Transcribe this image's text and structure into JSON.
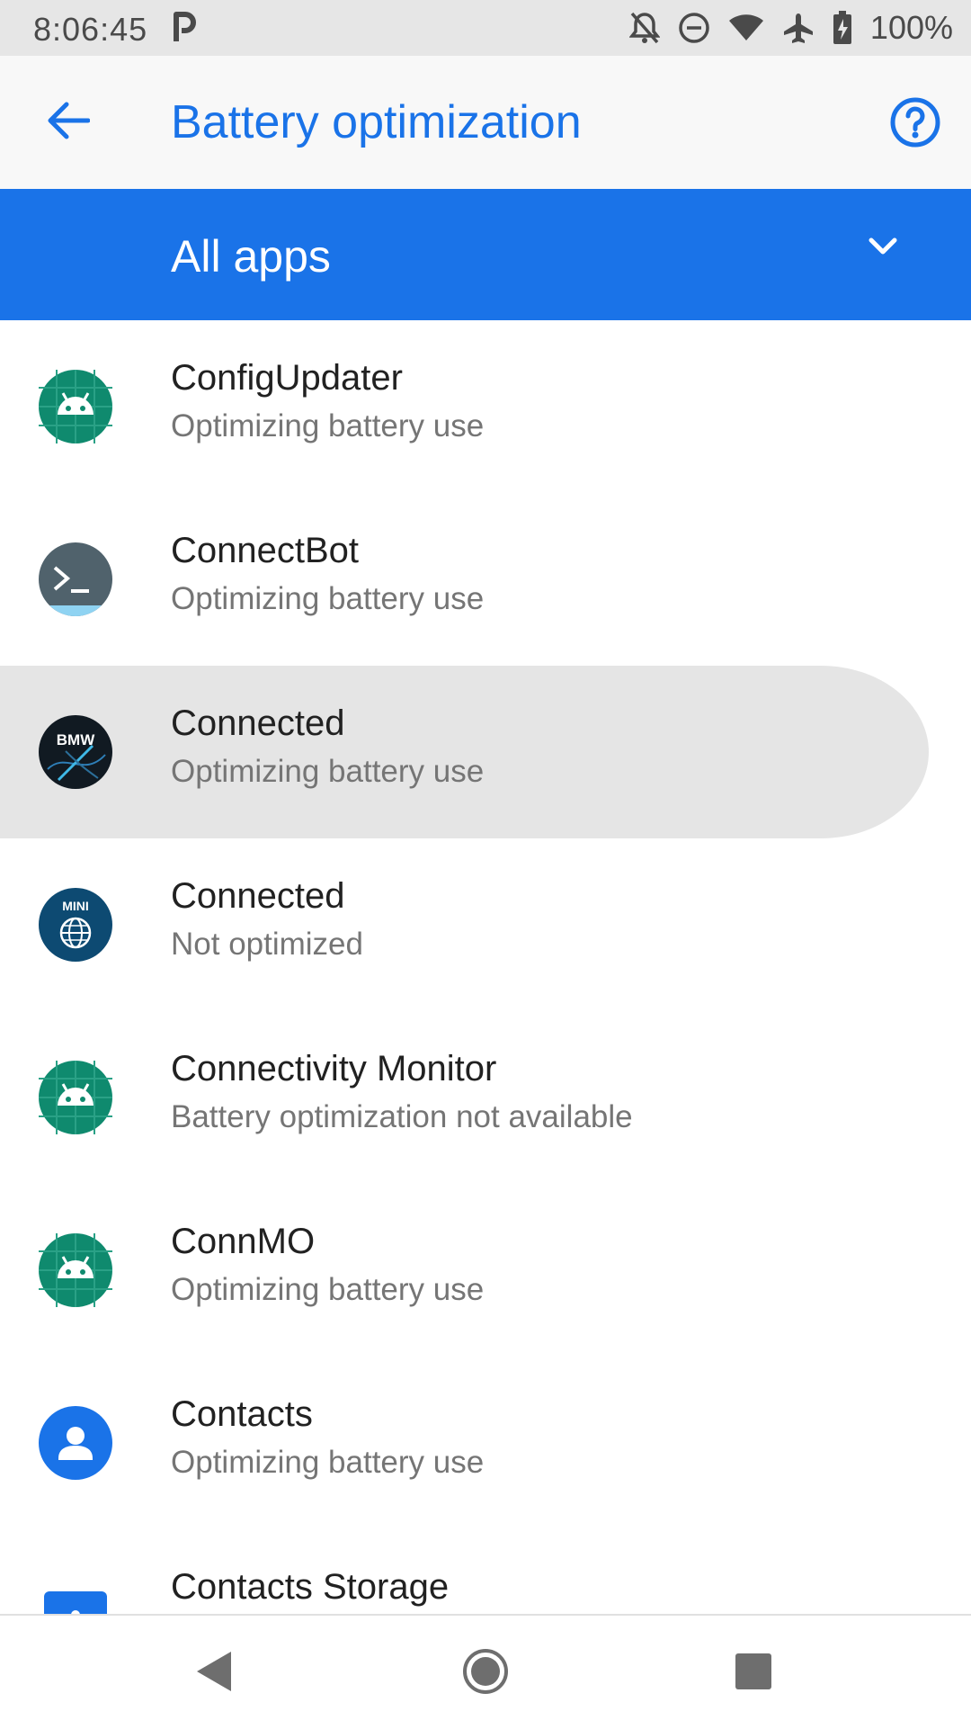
{
  "status_bar": {
    "time": "8:06:45",
    "battery": "100%",
    "icons": [
      "parking-icon",
      "notifications-off-icon",
      "do-not-disturb-icon",
      "wifi-icon",
      "airplane-mode-icon",
      "battery-charging-icon"
    ]
  },
  "app_bar": {
    "title": "Battery optimization",
    "back_icon": "arrow-back-icon",
    "help_icon": "help-icon"
  },
  "filter": {
    "label": "All apps",
    "icon": "chevron-down-icon"
  },
  "apps": [
    {
      "name": "ConfigUpdater",
      "status": "Optimizing battery use",
      "icon": "android-icon"
    },
    {
      "name": "ConnectBot",
      "status": "Optimizing battery use",
      "icon": "terminal-icon"
    },
    {
      "name": "Connected",
      "status": "Optimizing battery use",
      "icon": "bmw-icon",
      "icon_text": "BMW"
    },
    {
      "name": "Connected",
      "status": "Not optimized",
      "icon": "mini-icon",
      "icon_text": "MINI"
    },
    {
      "name": "Connectivity Monitor",
      "status": "Battery optimization not available",
      "icon": "android-icon"
    },
    {
      "name": "ConnMO",
      "status": "Optimizing battery use",
      "icon": "android-icon"
    },
    {
      "name": "Contacts",
      "status": "Optimizing battery use",
      "icon": "contacts-icon"
    },
    {
      "name": "Contacts Storage",
      "status": "",
      "icon": "contacts-storage-icon"
    }
  ],
  "nav_bar": {
    "icons": [
      "back-icon",
      "home-icon",
      "recents-icon"
    ]
  },
  "colors": {
    "accent": "#1a73e8",
    "status_bar_bg": "#e6e6e6",
    "app_bar_bg": "#f8f8f8",
    "pressed_bg": "#e5e5e5",
    "android_icon_bg": "#0f8a6e",
    "primary_text": "#212121",
    "secondary_text": "#757575"
  }
}
